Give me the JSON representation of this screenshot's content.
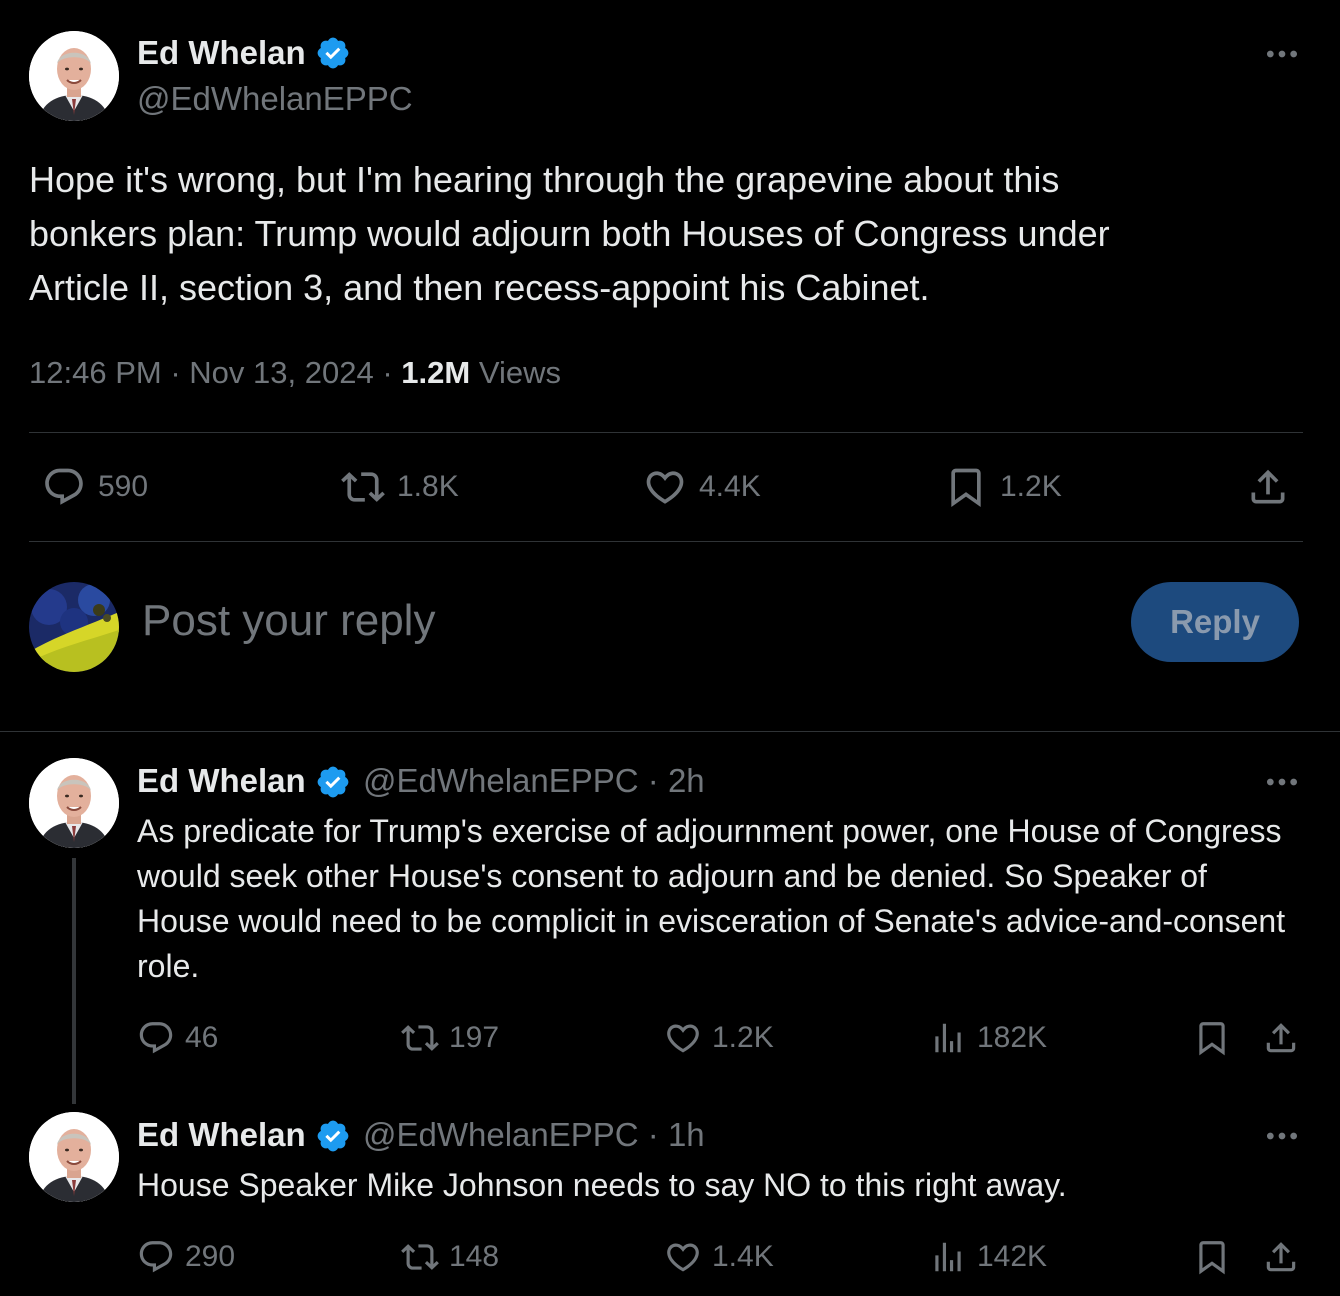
{
  "main_tweet": {
    "author_name": "Ed Whelan",
    "handle": "@EdWhelanEPPC",
    "text": "Hope it's wrong, but I'm hearing through the grapevine about this\nbonkers plan: Trump would adjourn both Houses of Congress under\nArticle II, section 3, and then recess-appoint his Cabinet.",
    "time": "12:46 PM",
    "date": "Nov 13, 2024",
    "separator": "·",
    "views_count": "1.2M",
    "views_label": "Views",
    "stats": {
      "replies": "590",
      "reposts": "1.8K",
      "likes": "4.4K",
      "bookmarks": "1.2K"
    }
  },
  "composer": {
    "placeholder": "Post your reply",
    "button_label": "Reply"
  },
  "replies": [
    {
      "author_name": "Ed Whelan",
      "handle": "@EdWhelanEPPC",
      "age": "· 2h",
      "text": "As predicate for Trump's exercise of adjournment power, one House of Congress would seek other House's consent to adjourn and be denied. So Speaker of House would need to be complicit in evisceration of Senate's advice-and-consent role.",
      "stats": {
        "replies": "46",
        "reposts": "197",
        "likes": "1.2K",
        "views": "182K"
      }
    },
    {
      "author_name": "Ed Whelan",
      "handle": "@EdWhelanEPPC",
      "age": "· 1h",
      "text": "House Speaker Mike Johnson needs to say NO to this right away.",
      "stats": {
        "replies": "290",
        "reposts": "148",
        "likes": "1.4K",
        "views": "142K"
      }
    }
  ],
  "colors": {
    "background": "#000000",
    "text_primary": "#e7e9ea",
    "text_secondary": "#71767b",
    "verified_blue": "#1d9bf0",
    "divider": "#2f3336",
    "reply_button_bg": "#1d4a7e"
  },
  "icons": {
    "verified": "verified-badge-icon",
    "more": "more-dots-icon",
    "reply": "reply-bubble-icon",
    "repost": "repost-icon",
    "like": "heart-icon",
    "bookmark": "bookmark-icon",
    "share": "share-icon",
    "views": "views-bar-icon"
  }
}
